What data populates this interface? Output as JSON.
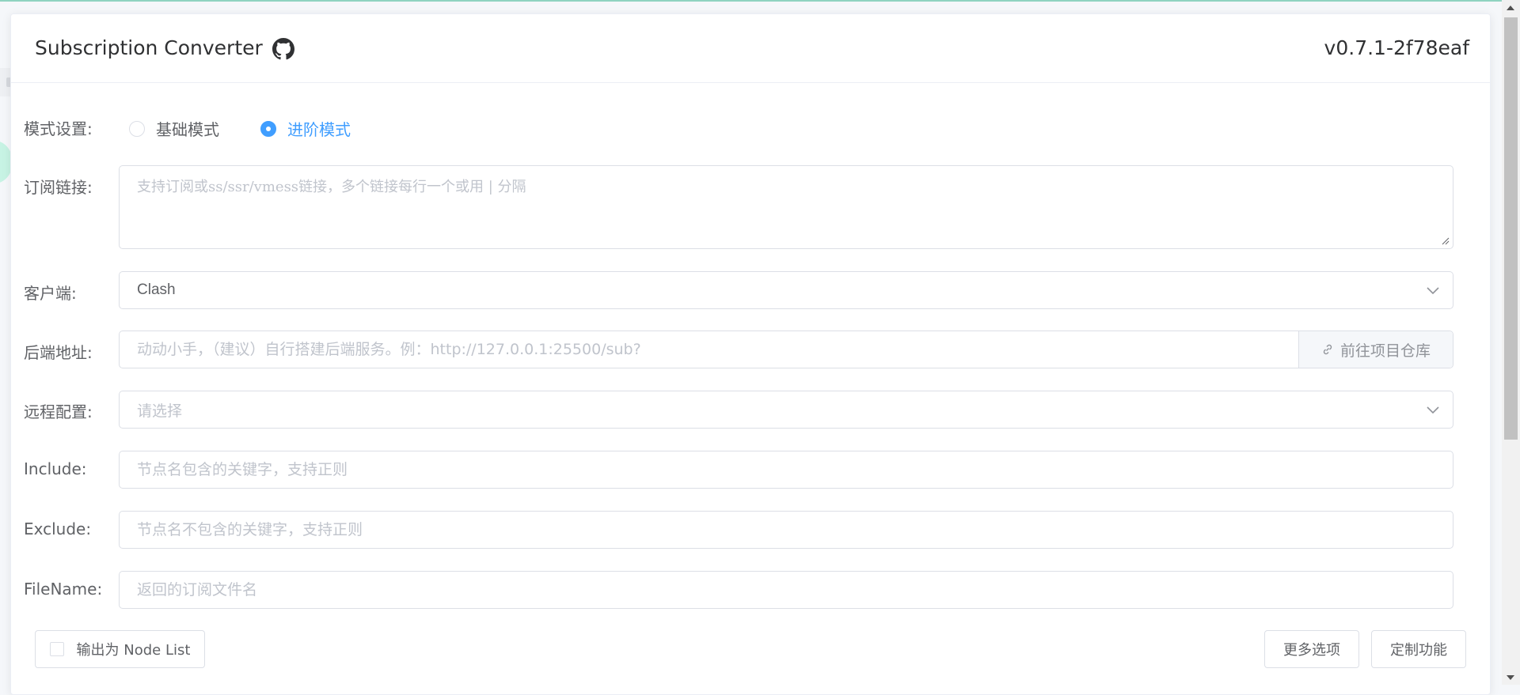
{
  "header": {
    "title": "Subscription Converter",
    "version": "v0.7.1-2f78eaf"
  },
  "mode": {
    "label": "模式设置:",
    "options": [
      "基础模式",
      "进阶模式"
    ],
    "selected": "进阶模式"
  },
  "subscription": {
    "label": "订阅链接:",
    "value": "",
    "placeholder": "支持订阅或ss/ssr/vmess链接，多个链接每行一个或用 | 分隔"
  },
  "client": {
    "label": "客户端:",
    "value": "Clash"
  },
  "backend": {
    "label": "后端地址:",
    "value": "",
    "placeholder": "动动小手，（建议）自行搭建后端服务。例：http://127.0.0.1:25500/sub?",
    "append_label": "前往项目仓库"
  },
  "remote_config": {
    "label": "远程配置:",
    "placeholder": "请选择"
  },
  "include": {
    "label": "Include:",
    "value": "",
    "placeholder": "节点名包含的关键字，支持正则"
  },
  "exclude": {
    "label": "Exclude:",
    "value": "",
    "placeholder": "节点名不包含的关键字，支持正则"
  },
  "filename": {
    "label": "FileName:",
    "value": "",
    "placeholder": "返回的订阅文件名"
  },
  "actions": {
    "node_list_label": "输出为 Node List",
    "node_list_checked": false,
    "more_options_label": "更多选项",
    "custom_label": "定制功能"
  },
  "colors": {
    "accent": "#409eff",
    "border": "#dcdfe6",
    "placeholder": "#c0c4cc"
  }
}
